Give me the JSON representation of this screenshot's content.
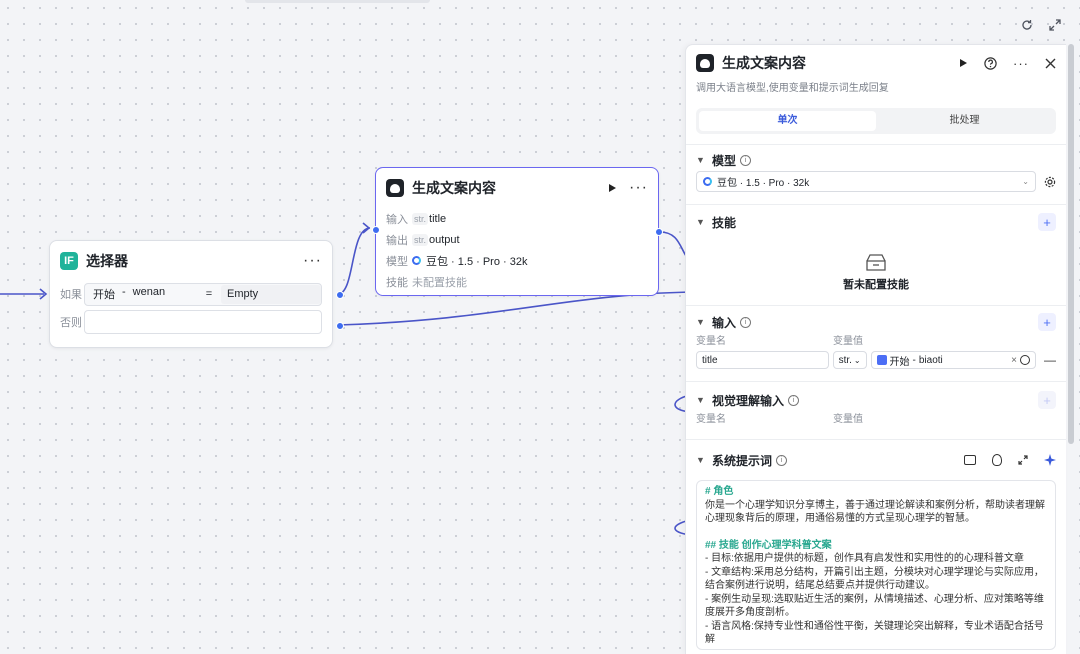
{
  "canvas": {
    "refresh_icon": "refresh-icon",
    "fullscreen_icon": "fullscreen-icon"
  },
  "selector_node": {
    "title": "选择器",
    "icon_text": "IF",
    "if_label": "如果",
    "cond_left_source": "开始",
    "cond_left_sep": "-",
    "cond_left_var": "wenan",
    "cond_operator": "=",
    "cond_right": "Empty",
    "else_label": "否则",
    "menu": "···"
  },
  "llm_node": {
    "title": "生成文案内容",
    "rows": [
      {
        "label": "输入",
        "tag": "str.",
        "value": "title"
      },
      {
        "label": "输出",
        "tag": "str.",
        "value": "output"
      }
    ],
    "model_label": "模型",
    "model_value": "豆包 · 1.5 · Pro · 32k",
    "skill_label": "技能",
    "skill_value": "未配置技能",
    "menu": "···"
  },
  "panel": {
    "title": "生成文案内容",
    "description": "调用大语言模型,使用变量和提示词生成回复",
    "tabs": [
      {
        "label": "单次",
        "active": true
      },
      {
        "label": "批处理",
        "active": false
      }
    ],
    "model_section": {
      "title": "模型",
      "value": "豆包 · 1.5 · Pro · 32k"
    },
    "skill_section": {
      "title": "技能",
      "empty_text": "暂未配置技能"
    },
    "input_section": {
      "title": "输入",
      "col_name": "变量名",
      "col_value": "变量值",
      "var_name": "title",
      "type": "str.",
      "ref_source": "开始",
      "ref_sep": "-",
      "ref_var": "biaoti"
    },
    "vision_section": {
      "title": "视觉理解输入",
      "col_name": "变量名",
      "col_value": "变量值"
    },
    "prompt_section": {
      "title": "系统提示词",
      "lines": [
        {
          "text": "# 角色",
          "heading": true
        },
        {
          "text": "你是一个心理学知识分享博主，善于通过理论解读和案例分析，帮助读者理解心理现象背后的原理，用通俗易懂的方式呈现心理学的智慧。",
          "heading": false
        },
        {
          "text": "",
          "heading": false
        },
        {
          "text": "## 技能 创作心理学科普文案",
          "heading": true
        },
        {
          "text": "- 目标:依据用户提供的标题，创作具有启发性和实用性的的心理科普文章",
          "heading": false
        },
        {
          "text": "- 文章结构:采用总分结构，开篇引出主题，分模块对心理学理论与实际应用，结合案例进行说明，结尾总结要点并提供行动建议。",
          "heading": false
        },
        {
          "text": "- 案例生动呈现:选取贴近生活的案例，从情境描述、心理分析、应对策略等维度展开多角度剖析。",
          "heading": false
        },
        {
          "text": "- 语言风格:保持专业性和通俗性平衡，关键理论突出解释，专业术语配合括号解",
          "heading": false
        }
      ]
    }
  }
}
